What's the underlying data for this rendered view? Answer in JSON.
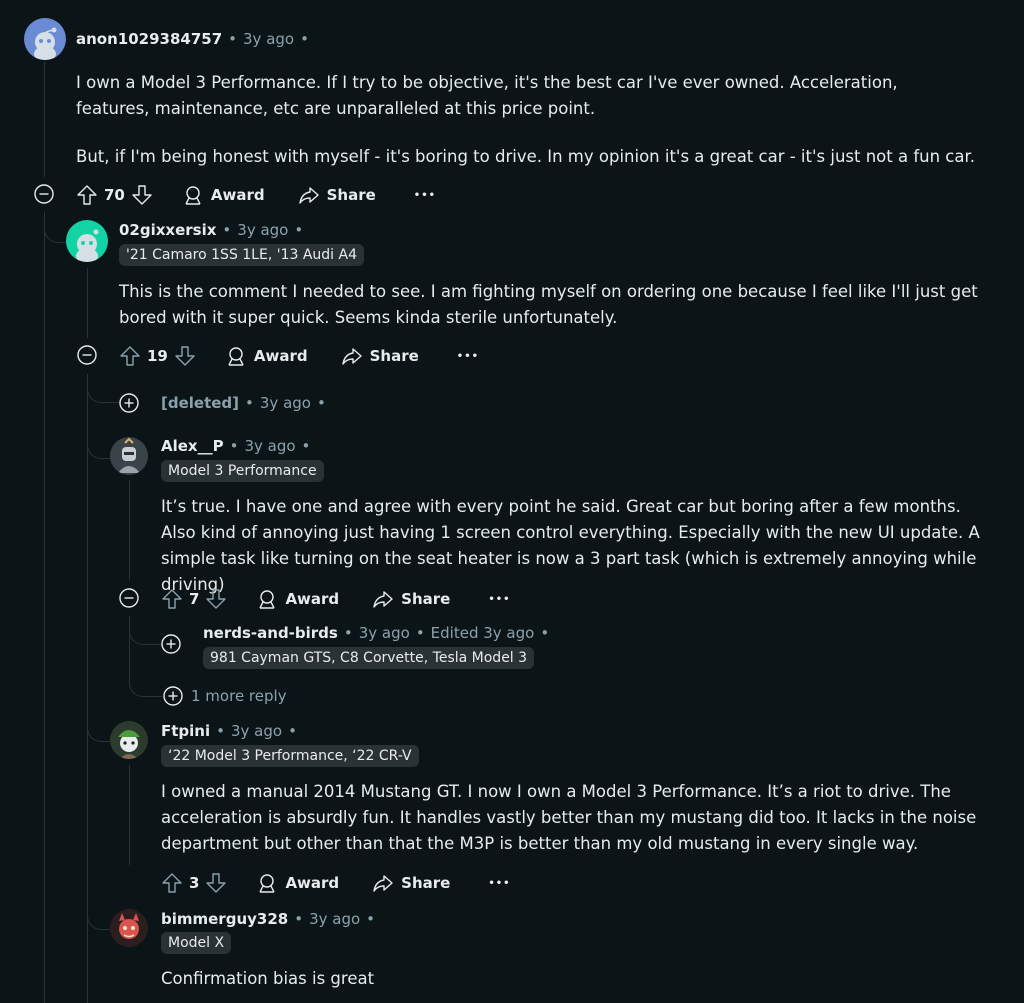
{
  "comments": [
    {
      "username": "anon1029384757",
      "time": "3y ago",
      "flair": "",
      "paragraphs": [
        "I own a Model 3 Performance. If I try to be objective, it's the best car I've ever owned. Acceleration, features, maintenance, etc are unparalleled at this price point.",
        "But, if I'm being honest with myself - it's boring to drive. In my opinion it's a great car - it's just not a fun car."
      ],
      "votes": "70",
      "avatar_icon": "snoo-avatar-blue"
    },
    {
      "username": "02gixxersix",
      "time": "3y ago",
      "flair": "'21 Camaro 1SS 1LE, '13 Audi A4",
      "paragraphs": [
        "This is the comment I needed to see. I am fighting myself on ordering one because I feel like I'll just get bored with it super quick. Seems kinda sterile unfortunately."
      ],
      "votes": "19",
      "avatar_icon": "snoo-avatar-teal"
    },
    {
      "username": "[deleted]",
      "time": "3y ago"
    },
    {
      "username": "Alex__P",
      "time": "3y ago",
      "flair": "Model 3 Performance",
      "paragraphs": [
        "It’s true. I have one and agree with every point he said. Great car but boring after a few months. Also kind of annoying just having 1 screen control everything. Especially with the new UI update. A simple task like turning on the seat heater is now a 3 part task (which is extremely annoying while driving)"
      ],
      "votes": "7",
      "avatar_icon": "knight-avatar"
    },
    {
      "username": "nerds-and-birds",
      "time": "3y ago",
      "edited": "Edited 3y ago",
      "flair": "981 Cayman GTS, C8 Corvette, Tesla Model 3"
    },
    {
      "username": "Ftpini",
      "time": "3y ago",
      "flair": "‘22 Model 3 Performance, ‘22 CR-V",
      "paragraphs": [
        "I owned a manual 2014 Mustang GT. I now I own a Model 3 Performance. It’s a riot to drive. The acceleration is absurdly fun. It handles vastly better than my mustang did too. It lacks in the noise department but other than that the M3P is better than my old mustang in every single way."
      ],
      "votes": "3",
      "avatar_icon": "green-hat-avatar"
    },
    {
      "username": "bimmerguy328",
      "time": "3y ago",
      "flair": "Model X",
      "paragraphs": [
        "Confirmation bias is great"
      ],
      "avatar_icon": "demon-avatar"
    }
  ],
  "labels": {
    "award": "Award",
    "share": "Share",
    "more": "•••",
    "more_replies": "1 more reply",
    "dot": "•"
  },
  "colors": {
    "background": "#0b1416",
    "text": "#e7ecee",
    "muted": "#8ba2ad",
    "flair_bg": "#2a3236",
    "thread_line": "#2a3236"
  }
}
